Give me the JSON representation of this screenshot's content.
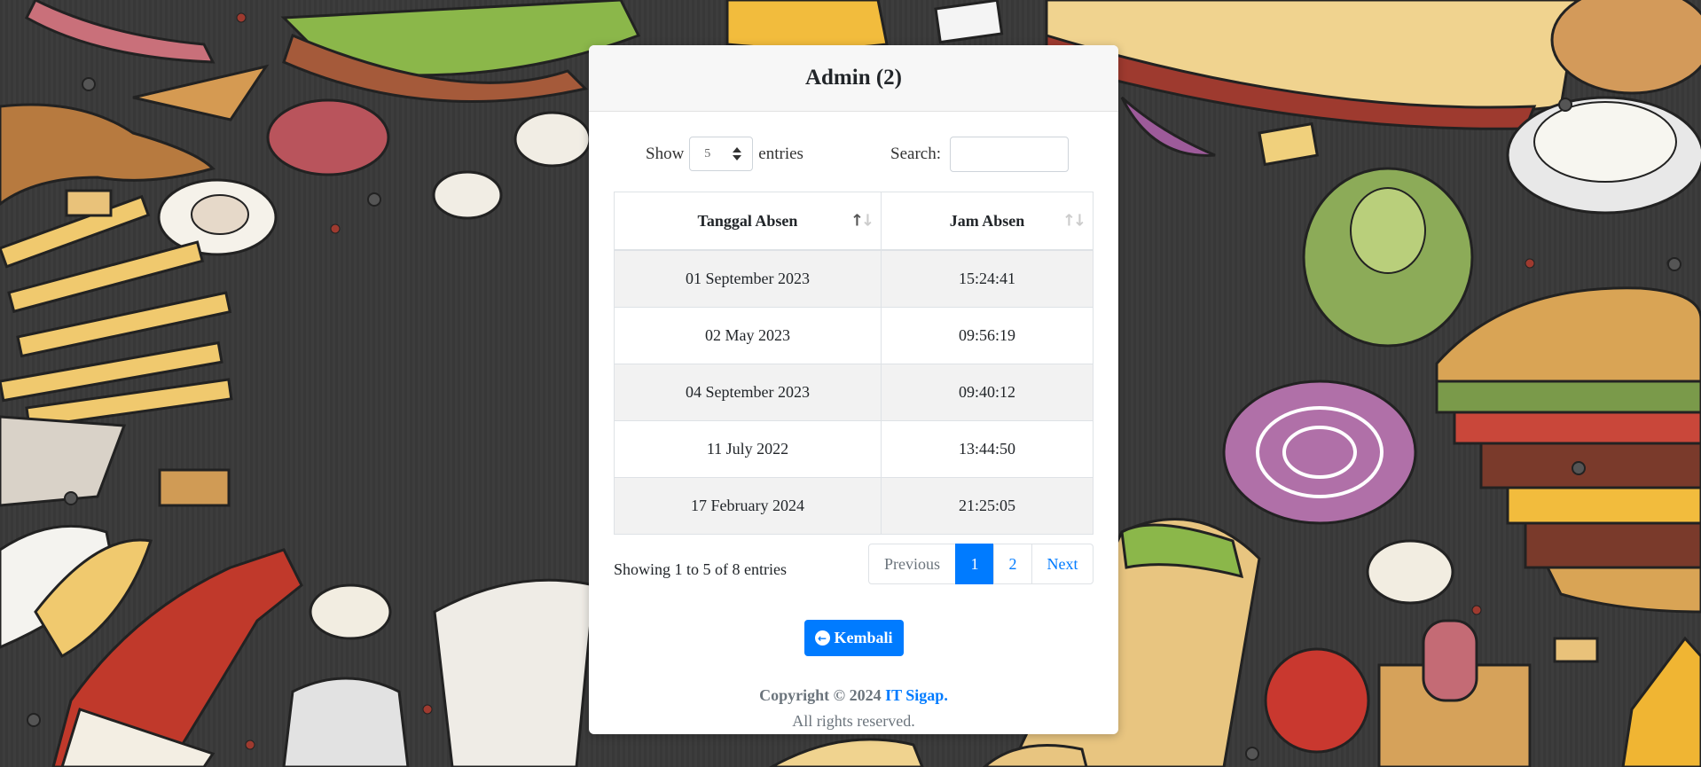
{
  "page": {
    "title": "Admin (2)"
  },
  "controls": {
    "show_label": "Show",
    "entries_label": "entries",
    "length_value": "5",
    "search_label": "Search:",
    "search_value": ""
  },
  "table": {
    "columns": [
      "Tanggal Absen",
      "Jam Absen"
    ],
    "rows": [
      {
        "date": "01 September 2023",
        "time": "15:24:41"
      },
      {
        "date": "02 May 2023",
        "time": "09:56:19"
      },
      {
        "date": "04 September 2023",
        "time": "09:40:12"
      },
      {
        "date": "11 July 2022",
        "time": "13:44:50"
      },
      {
        "date": "17 February 2024",
        "time": "21:25:05"
      }
    ]
  },
  "pagination": {
    "info": "Showing 1 to 5 of 8 entries",
    "previous": "Previous",
    "pages": [
      "1",
      "2"
    ],
    "active_page": "1",
    "next": "Next"
  },
  "actions": {
    "back_label": "Kembali",
    "back_icon": "arrow-circle-left-icon"
  },
  "footer": {
    "copyright": "Copyright © 2024",
    "brand": "IT Sigap.",
    "rights": "All rights reserved."
  },
  "colors": {
    "primary": "#007bff",
    "background": "#3a3a3a",
    "card_header": "#f7f7f7"
  }
}
